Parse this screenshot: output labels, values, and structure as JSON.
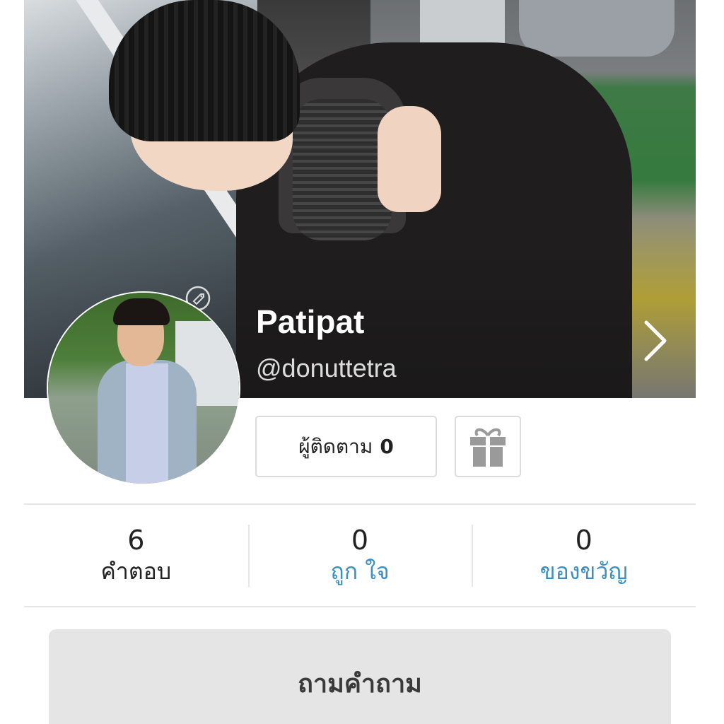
{
  "profile": {
    "name": "Patipat",
    "handle": "@donuttetra"
  },
  "actions": {
    "followers_label": "ผู้ติดตาม",
    "followers_count": "0",
    "gift_icon": "gift-icon"
  },
  "stats": [
    {
      "value": "6",
      "label": "คำตอบ"
    },
    {
      "value": "0",
      "label": "ถูก ใจ"
    },
    {
      "value": "0",
      "label": "ของขวัญ"
    }
  ],
  "ask_button": {
    "label": "ถามคำถาม"
  },
  "colors": {
    "link": "#3b8fbf",
    "button_bg": "#e5e5e5",
    "border": "#dcdcdc"
  }
}
